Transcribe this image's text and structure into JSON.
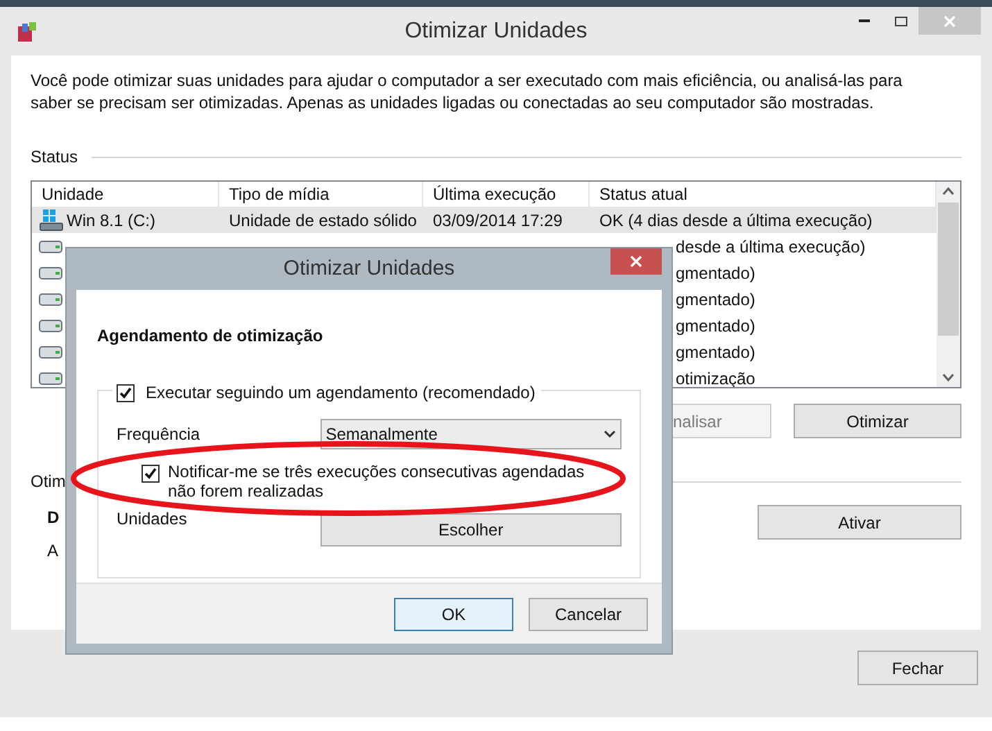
{
  "window": {
    "title": "Otimizar Unidades"
  },
  "description": "Você pode otimizar suas unidades para ajudar o computador a ser executado com mais eficiência, ou analisá-las para saber se precisam ser otimizadas. Apenas as unidades ligadas ou conectadas ao seu computador são mostradas.",
  "status_label": "Status",
  "drives": {
    "columns": [
      "Unidade",
      "Tipo de mídia",
      "Última execução",
      "Status atual"
    ],
    "rows": [
      {
        "kind": "system",
        "name": "Win 8.1 (C:)",
        "media": "Unidade de estado sólido",
        "last_run": "03/09/2014 17:29",
        "status": "OK (4 dias desde a última execução)",
        "selected": true
      },
      {
        "kind": "disk",
        "status": "desde a última execução)",
        "selected": false
      },
      {
        "kind": "disk",
        "status": "gmentado)",
        "selected": false
      },
      {
        "kind": "disk",
        "status": "gmentado)",
        "selected": false
      },
      {
        "kind": "disk",
        "status": "gmentado)",
        "selected": false
      },
      {
        "kind": "disk",
        "status": "gmentado)",
        "selected": false
      },
      {
        "kind": "disk",
        "status": "otimização",
        "selected": false
      }
    ]
  },
  "actions": [
    {
      "label": "nalisar",
      "disabled": true
    },
    {
      "label": "Otimizar",
      "disabled": false
    }
  ],
  "scheduled": {
    "label": "Otim",
    "lines": [
      "D",
      "A"
    ],
    "button": "Ativar"
  },
  "close_button": "Fechar",
  "dialog": {
    "title": "Otimizar Unidades",
    "heading": "Agendamento de otimização",
    "schedule": {
      "label": "Executar seguindo um agendamento (recomendado)",
      "checked": true
    },
    "frequency": {
      "label": "Frequência",
      "value": "Semanalmente"
    },
    "notify": {
      "label": "Notificar-me se três execuções consecutivas agendadas não forem realizadas",
      "checked": true
    },
    "drives": {
      "label": "Unidades",
      "button": "Escolher"
    },
    "buttons": [
      {
        "label": "OK",
        "default": true
      },
      {
        "label": "Cancelar",
        "default": false
      }
    ]
  }
}
